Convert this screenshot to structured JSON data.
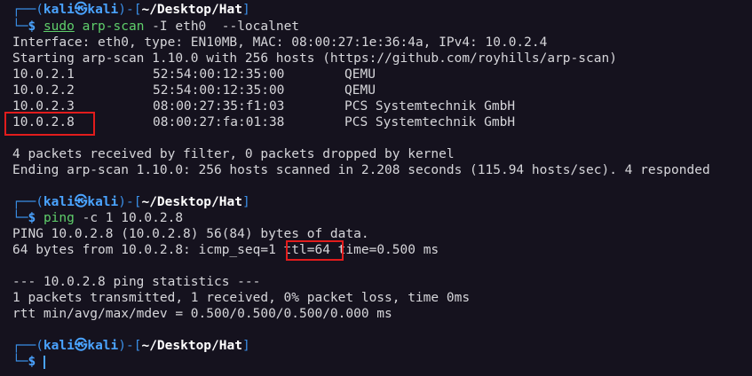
{
  "prompts": [
    {
      "user": "kali",
      "at": "㉿",
      "host": "kali",
      "dir": "~/Desktop/Hat",
      "sudo": "sudo",
      "command": "arp-scan",
      "args": " -I eth0  --localnet"
    },
    {
      "user": "kali",
      "at": "㉿",
      "host": "kali",
      "dir": "~/Desktop/Hat",
      "command": "ping",
      "args": " -c 1 10.0.2.8"
    },
    {
      "user": "kali",
      "at": "㉿",
      "host": "kali",
      "dir": "~/Desktop/Hat"
    }
  ],
  "arp_output": {
    "interface_line": "Interface: eth0, type: EN10MB, MAC: 08:00:27:1e:36:4a, IPv4: 10.0.2.4",
    "starting_line": "Starting arp-scan 1.10.0 with 256 hosts (https://github.com/royhills/arp-scan)",
    "hosts": [
      {
        "ip": "10.0.2.1",
        "mac": "52:54:00:12:35:00",
        "vendor": "QEMU"
      },
      {
        "ip": "10.0.2.2",
        "mac": "52:54:00:12:35:00",
        "vendor": "QEMU"
      },
      {
        "ip": "10.0.2.3",
        "mac": "08:00:27:35:f1:03",
        "vendor": "PCS Systemtechnik GmbH"
      },
      {
        "ip": "10.0.2.8",
        "mac": "08:00:27:fa:01:38",
        "vendor": "PCS Systemtechnik GmbH"
      }
    ],
    "packets_line": "4 packets received by filter, 0 packets dropped by kernel",
    "ending_line": "Ending arp-scan 1.10.0: 256 hosts scanned in 2.208 seconds (115.94 hosts/sec). 4 responded"
  },
  "ping_output": {
    "header": "PING 10.0.2.8 (10.0.2.8) 56(84) bytes of data.",
    "reply_prefix": "64 bytes from 10.0.2.8: icmp_seq=1 ",
    "reply_ttl": "ttl=64",
    "reply_suffix": " time=0.500 ms",
    "stats_header": "--- 10.0.2.8 ping statistics ---",
    "stats_line": "1 packets transmitted, 1 received, 0% packet loss, time 0ms",
    "rtt_line": "rtt min/avg/max/mdev = 0.500/0.500/0.500/0.000 ms"
  },
  "colors": {
    "background": "#15121e",
    "prompt_blue": "#4aa3ff",
    "command_green": "#5fcf6b",
    "highlight_red": "#e21c1c"
  }
}
